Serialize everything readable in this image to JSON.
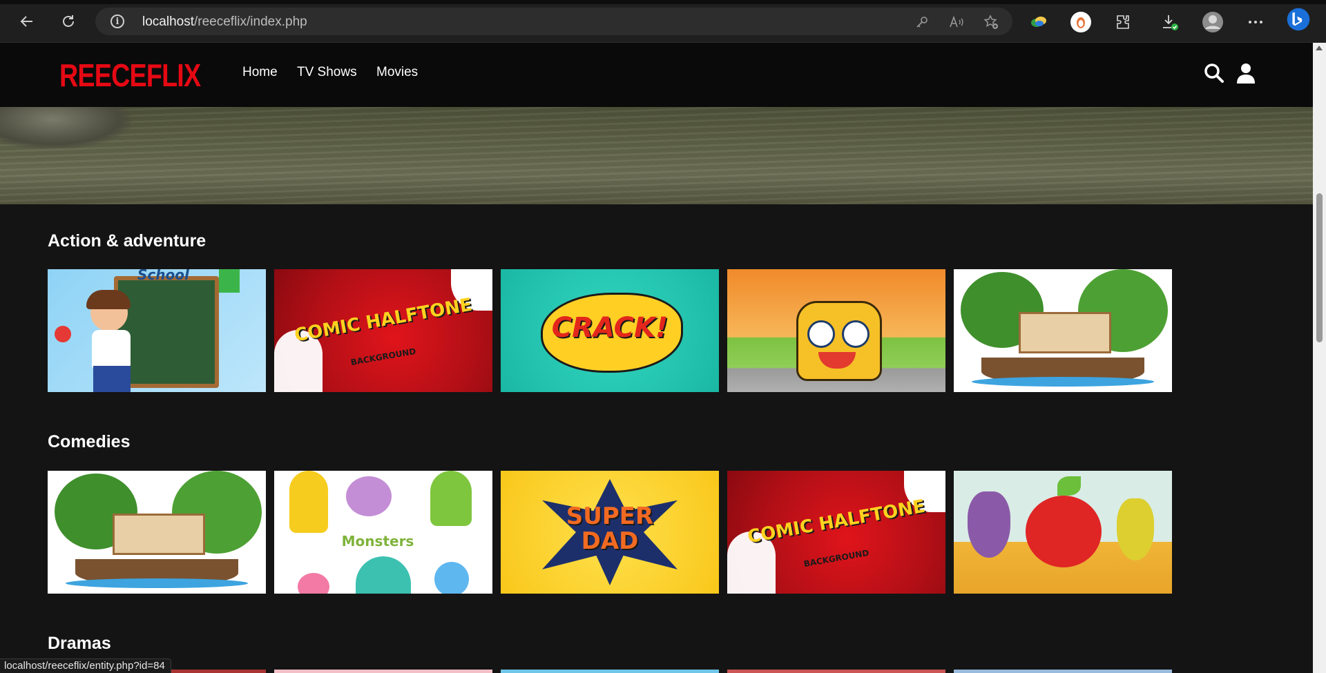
{
  "browser": {
    "url_host": "localhost",
    "url_path": "/reeceflix/index.php",
    "status_url": "localhost/reeceflix/entity.php?id=84"
  },
  "site": {
    "logo": "REECEFLIX",
    "nav": [
      "Home",
      "TV Shows",
      "Movies"
    ]
  },
  "categories": [
    {
      "title": "Action & adventure",
      "items": [
        {
          "scene": "school",
          "text": "School"
        },
        {
          "scene": "comic",
          "text": "COMIC HALFTONE",
          "sub": "BACKGROUND"
        },
        {
          "scene": "crack",
          "text": "CRACK!"
        },
        {
          "scene": "bus",
          "text": ""
        },
        {
          "scene": "jungle",
          "text": ""
        }
      ]
    },
    {
      "title": "Comedies",
      "items": [
        {
          "scene": "jungle",
          "text": ""
        },
        {
          "scene": "monsters",
          "text": "Monsters"
        },
        {
          "scene": "superdad",
          "text": "SUPER DAD"
        },
        {
          "scene": "comic",
          "text": "COMIC HALFTONE",
          "sub": "BACKGROUND"
        },
        {
          "scene": "fruits",
          "text": ""
        }
      ]
    },
    {
      "title": "Dramas",
      "items": []
    }
  ],
  "colors": {
    "brand": "#e50914",
    "background": "#141414"
  }
}
